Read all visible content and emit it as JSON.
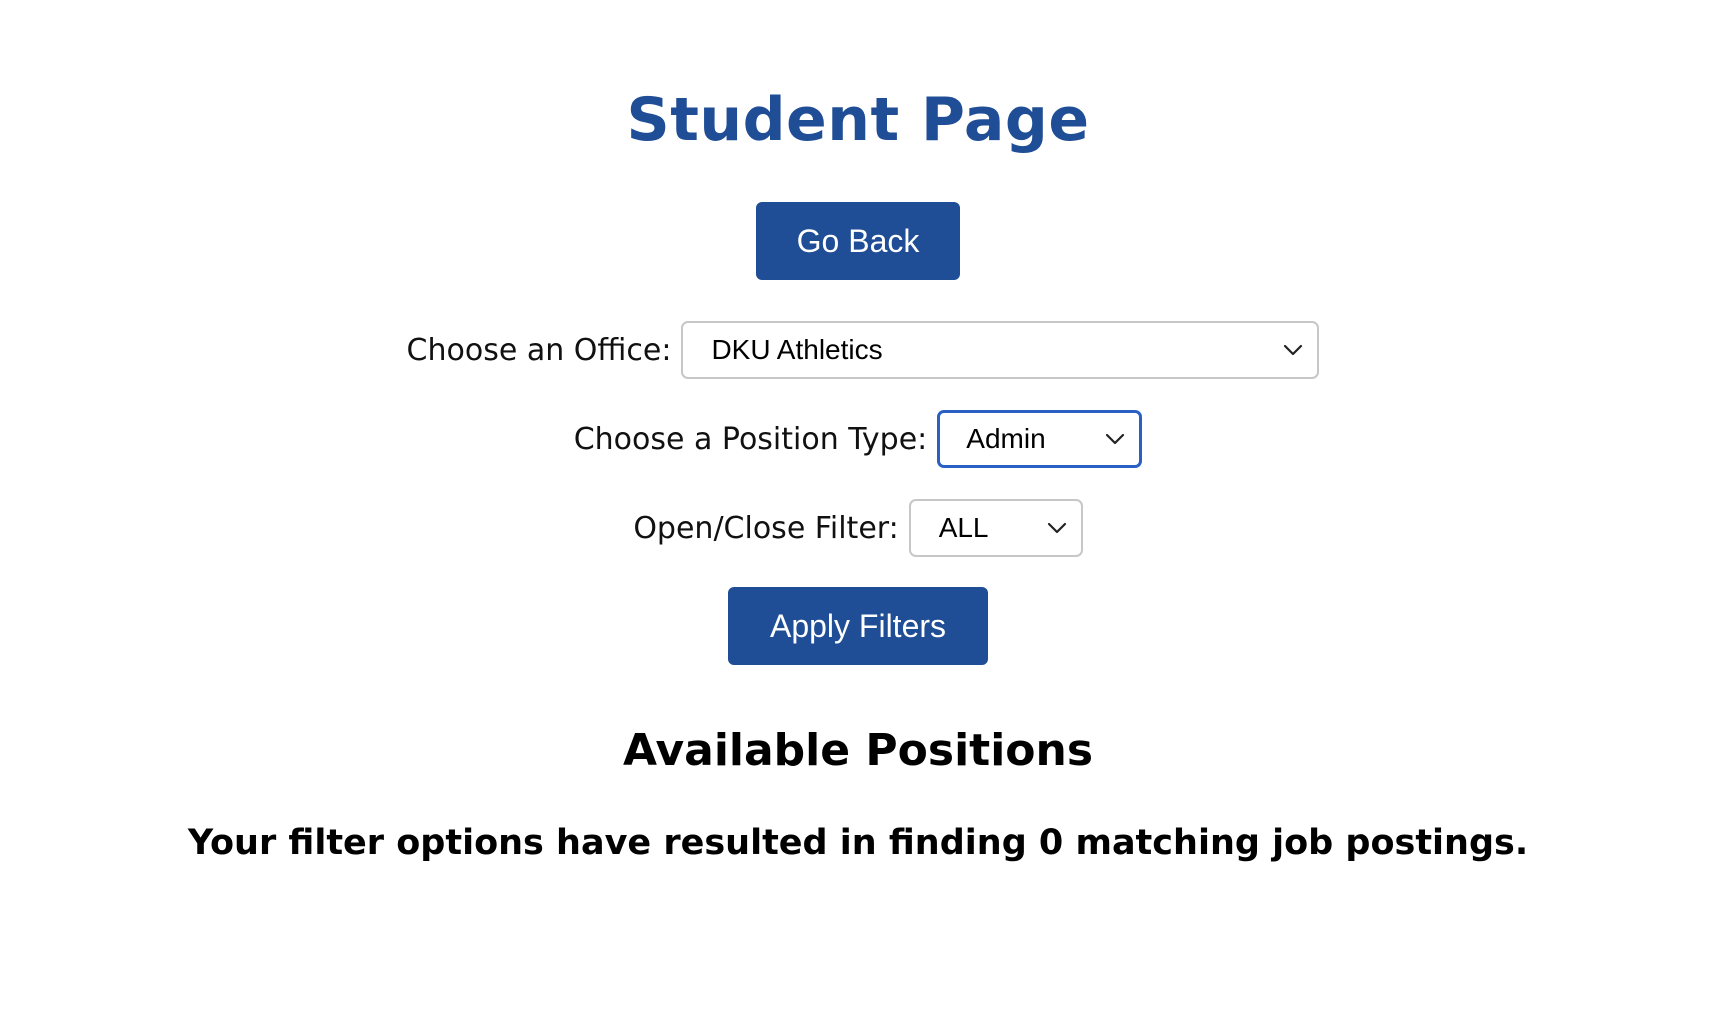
{
  "header": {
    "title": "Student Page",
    "go_back_label": "Go Back"
  },
  "filters": {
    "office": {
      "label": "Choose an Office:",
      "selected": "DKU Athletics"
    },
    "position_type": {
      "label": "Choose a Position Type:",
      "selected": "Admin"
    },
    "open_close": {
      "label": "Open/Close Filter:",
      "selected": "ALL"
    },
    "apply_label": "Apply Filters"
  },
  "results": {
    "heading": "Available Positions",
    "message": "Your filter options have resulted in finding 0 matching job postings."
  },
  "colors": {
    "brand_blue": "#1f4d96",
    "focus_blue": "#2a5fc4",
    "select_border": "#c7c7c7"
  },
  "icons": {
    "dropdown": "chevron-down-icon"
  }
}
